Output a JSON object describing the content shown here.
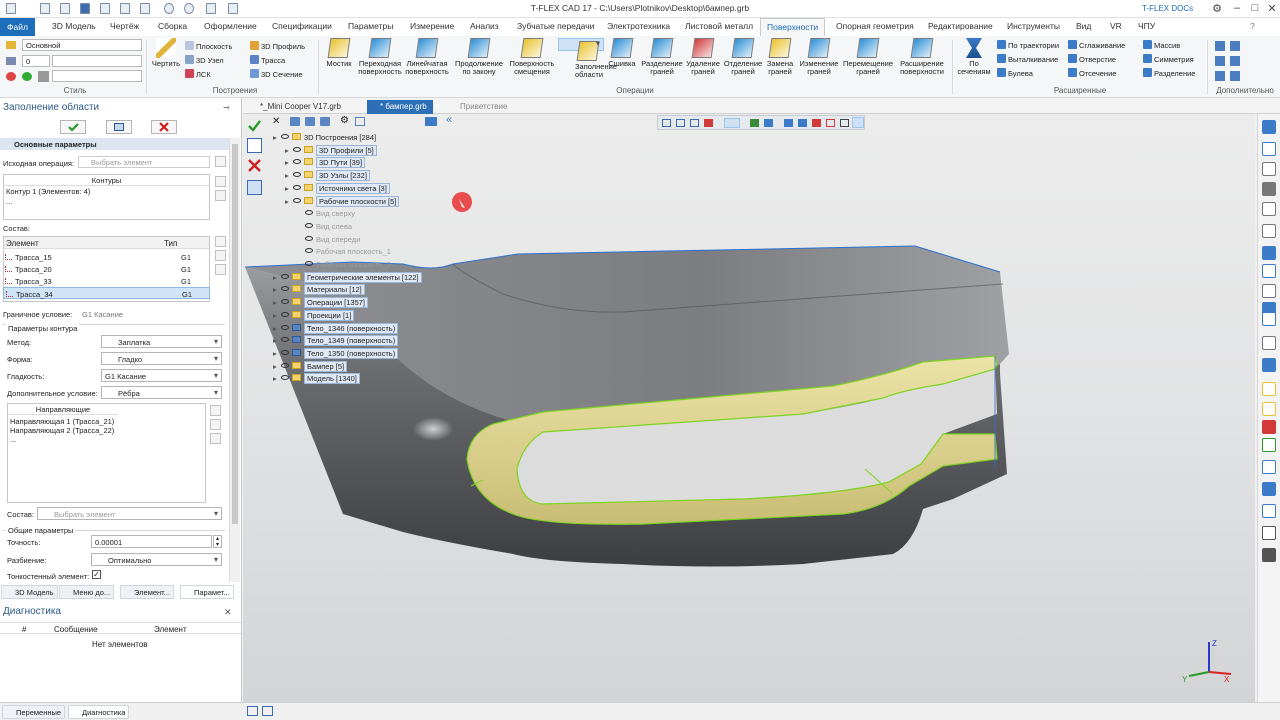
{
  "title": "T-FLEX CAD 17 - C:\\Users\\Plotnikov\\Desktop\\бампер.grb",
  "docs_account": "T-FLEX DOCs",
  "menu_tabs": [
    "Файл",
    "3D Модель",
    "Чертёж",
    "Сборка",
    "Оформление",
    "Спецификации",
    "Параметры",
    "Измерение",
    "Анализ",
    "Зубчатые передачи",
    "Электротехника",
    "Листовой металл",
    "Поверхности",
    "Опорная геометрия",
    "Редактирование",
    "Инструменты",
    "Вид",
    "VR",
    "ЧПУ"
  ],
  "active_tab": "Поверхности",
  "ribbon": {
    "style": {
      "layer_combo": "Основной",
      "num_combo": "0",
      "group_label": "Стиль"
    },
    "build": {
      "draw": "Чертить",
      "plane": "Плоскость",
      "node3d": "3D Узел",
      "lsk": "ЛСК",
      "profile3d": "3D Профиль",
      "trace": "Трасса",
      "section3d": "3D Сечение",
      "group_label": "Построения"
    },
    "ops": [
      {
        "label": "Мостик",
        "color": "#e8c22e"
      },
      {
        "label": "Переходная поверхность",
        "color": "#2f8fd6"
      },
      {
        "label": "Линейчатая поверхность",
        "color": "#2f8fd6"
      },
      {
        "label": "Продолжение по закону",
        "color": "#2f8fd6"
      },
      {
        "label": "Поверхность смещения",
        "color": "#e8c22e"
      },
      {
        "label": "Заполнение области",
        "color": "#e8c22e"
      },
      {
        "label": "Сшивка",
        "color": "#2f8fd6"
      },
      {
        "label": "Разделение граней",
        "color": "#2f8fd6"
      },
      {
        "label": "Удаление граней",
        "color": "#d23a3a"
      },
      {
        "label": "Отделение граней",
        "color": "#2f8fd6"
      },
      {
        "label": "Замена граней",
        "color": "#e8c22e"
      },
      {
        "label": "Изменение граней",
        "color": "#2f8fd6"
      },
      {
        "label": "Перемещение граней",
        "color": "#2f8fd6"
      },
      {
        "label": "Расширение поверхности",
        "color": "#2f8fd6"
      }
    ],
    "ops_group_label": "Операции",
    "ext": {
      "by_sections": "По сечениям",
      "by_trajectory": "По траектории",
      "extrude": "Выталкивание",
      "boolean": "Булева",
      "smoothing": "Сглаживание",
      "hole": "Отверстие",
      "cut": "Отсечение",
      "array": "Массив",
      "symmetry": "Симметрия",
      "split": "Разделение",
      "group_label": "Расширенные"
    },
    "extra_label": "Дополнительно"
  },
  "panel": {
    "title": "Заполнение области",
    "section_main": "Основные параметры",
    "src_op_label": "Исходная операция:",
    "src_op_placeholder": "Выбрать элемент",
    "contours_header": "Контуры",
    "contours": [
      "Контур 1 (Элементов: 4)",
      "..."
    ],
    "composition_label": "Состав:",
    "grid_headers": [
      "Элемент",
      "Тип"
    ],
    "grid_rows": [
      {
        "name": "Трасса_15",
        "type": "G1"
      },
      {
        "name": "Трасса_20",
        "type": "G1"
      },
      {
        "name": "Трасса_33",
        "type": "G1"
      },
      {
        "name": "Трасса_34",
        "type": "G1"
      }
    ],
    "boundary_label": "Граничное условие:",
    "boundary_value": "G1 Касание",
    "contour_params": "Параметры контура",
    "method_label": "Метод:",
    "method_value": "Заплатка",
    "shape_label": "Форма:",
    "shape_value": "Гладко",
    "smooth_label": "Гладкость:",
    "smooth_value": "G1 Касание",
    "extra_label": "Дополнительное условие:",
    "extra_value": "Рёбра",
    "guides_header": "Направляющие",
    "guides": [
      "Направляющая 1 (Трасса_21)",
      "Направляющая 2 (Трасса_22)",
      "..."
    ],
    "comp2_label": "Состав:",
    "comp2_placeholder": "Выбрать элемент",
    "common_params": "Общие параметры",
    "accuracy_label": "Точность:",
    "accuracy_value": "0.00001",
    "split_label": "Разбиение:",
    "split_value": "Оптимально",
    "thin_label": "Тонкостенный элемент:"
  },
  "panel_tabs": [
    "3D Модель",
    "Меню до...",
    "Элемент...",
    "Парамет..."
  ],
  "diag": {
    "title": "Диагностика",
    "headers": [
      "#",
      "Сообщение",
      "Элемент"
    ],
    "empty": "Нет элементов"
  },
  "bottom_tabs": [
    "Переменные",
    "Диагностика"
  ],
  "doc_tabs": [
    "*_Mini Cooper V17.grb",
    "* бампер.grb",
    "Приветствие"
  ],
  "tree": [
    {
      "label": "3D Построения [284]",
      "lvl": 0
    },
    {
      "label": "3D Профили [5]",
      "lvl": 1
    },
    {
      "label": "3D Пути [39]",
      "lvl": 1
    },
    {
      "label": "3D Узлы [232]",
      "lvl": 1
    },
    {
      "label": "Источники света [3]",
      "lvl": 1
    },
    {
      "label": "Рабочие плоскости [5]",
      "lvl": 1
    },
    {
      "label": "Вид сверху",
      "lvl": 2
    },
    {
      "label": "Вид слева",
      "lvl": 2
    },
    {
      "label": "Вид спереди",
      "lvl": 2
    },
    {
      "label": "Рабочая плоскость_1",
      "lvl": 2
    },
    {
      "label": "Рабочая плоскость_2",
      "lvl": 2
    },
    {
      "label": "Геометрические элементы [122]",
      "lvl": 0
    },
    {
      "label": "Материалы [12]",
      "lvl": 0
    },
    {
      "label": "Операции [1357]",
      "lvl": 0
    },
    {
      "label": "Проекции [1]",
      "lvl": 0
    },
    {
      "label": "Тело_1346 (поверхность)",
      "lvl": 0
    },
    {
      "label": "Тело_1349 (поверхность)",
      "lvl": 0
    },
    {
      "label": "Тело_1350 (поверхность)",
      "lvl": 0
    },
    {
      "label": "Бампер [5]",
      "lvl": 0
    },
    {
      "label": "Модель [1340]",
      "lvl": 0
    }
  ],
  "axes": {
    "x": "X",
    "y": "Y",
    "z": "Z"
  }
}
